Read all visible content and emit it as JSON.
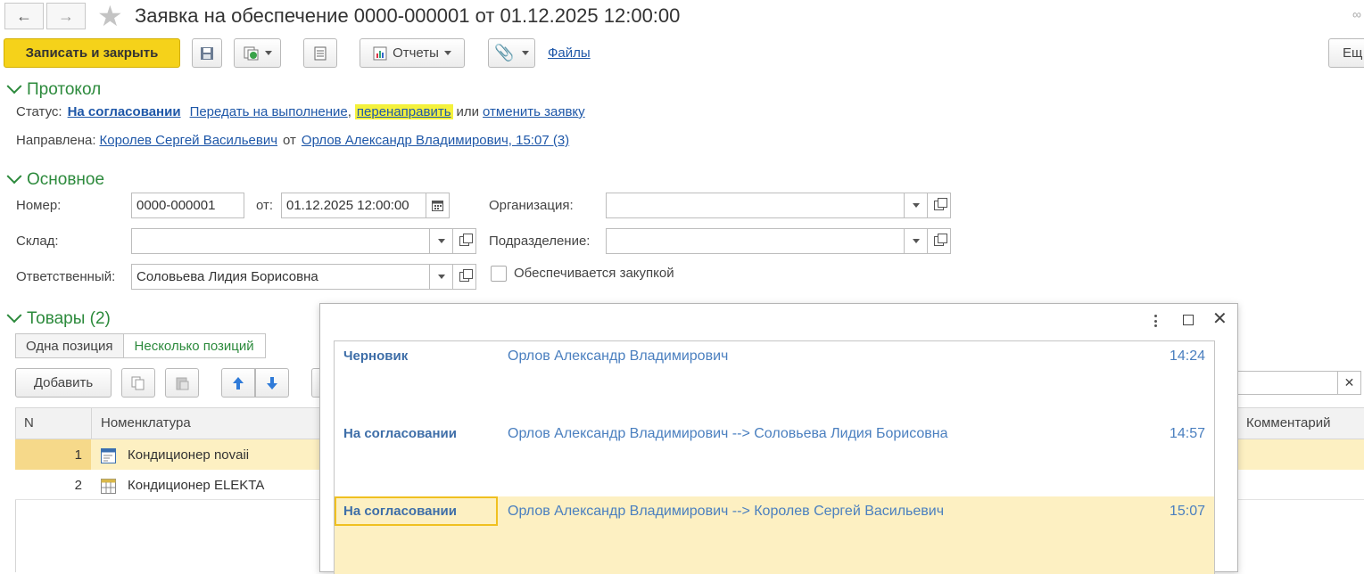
{
  "window": {
    "title": "Заявка на обеспечение 0000-000001 от 01.12.2025 12:00:00"
  },
  "toolbar": {
    "save_close": "Записать и закрыть",
    "reports": "Отчеты",
    "files": "Файлы",
    "more": "Ещ"
  },
  "protocol": {
    "title": "Протокол",
    "status_label": "Статус:",
    "status_value": "На согласовании",
    "action_transfer": "Передать на выполнение",
    "comma": ",",
    "action_redirect": "перенаправить",
    "or": "или",
    "action_cancel": "отменить заявку",
    "sent_label": "Направлена:",
    "sent_to": "Королев Сергей Васильевич",
    "from_word": "от",
    "sent_from": "Орлов Александр Владимирович, 15:07 (3)"
  },
  "main": {
    "title": "Основное",
    "number_label": "Номер:",
    "number_value": "0000-000001",
    "date_label": "от:",
    "date_value": "01.12.2025 12:00:00",
    "org_label": "Организация:",
    "org_value": "",
    "warehouse_label": "Склад:",
    "warehouse_value": "",
    "dept_label": "Подразделение:",
    "dept_value": "",
    "responsible_label": "Ответственный:",
    "responsible_value": "Соловьева Лидия Борисовна",
    "purchase_label": "Обеспечивается закупкой",
    "purchase_checked": false
  },
  "goods": {
    "title": "Товары (2)",
    "tab_single": "Одна позиция",
    "tab_multi": "Несколько позиций",
    "add_button": "Добавить",
    "col_n": "N",
    "col_item": "Номенклатура",
    "col_comment": "Комментарий",
    "rows": [
      {
        "n": "1",
        "item": "Кондиционер novaii"
      },
      {
        "n": "2",
        "item": "Кондиционер ELEKTA"
      }
    ]
  },
  "popup": {
    "rows": [
      {
        "status": "Черновик",
        "who": "Орлов Александр Владимирович",
        "time": "14:24"
      },
      {
        "status": "На согласовании",
        "who": "Орлов Александр Владимирович --> Соловьева Лидия Борисовна",
        "time": "14:57"
      },
      {
        "status": "На согласовании",
        "who": "Орлов Александр Владимирович --> Королев Сергей Васильевич",
        "time": "15:07"
      }
    ]
  },
  "colors": {
    "primary_button": "#f5d21a",
    "section_green": "#2c8a3c",
    "link_blue": "#1e57a8",
    "highlight_row": "#fdf0c2",
    "redirect_highlight": "#f4f13c"
  }
}
